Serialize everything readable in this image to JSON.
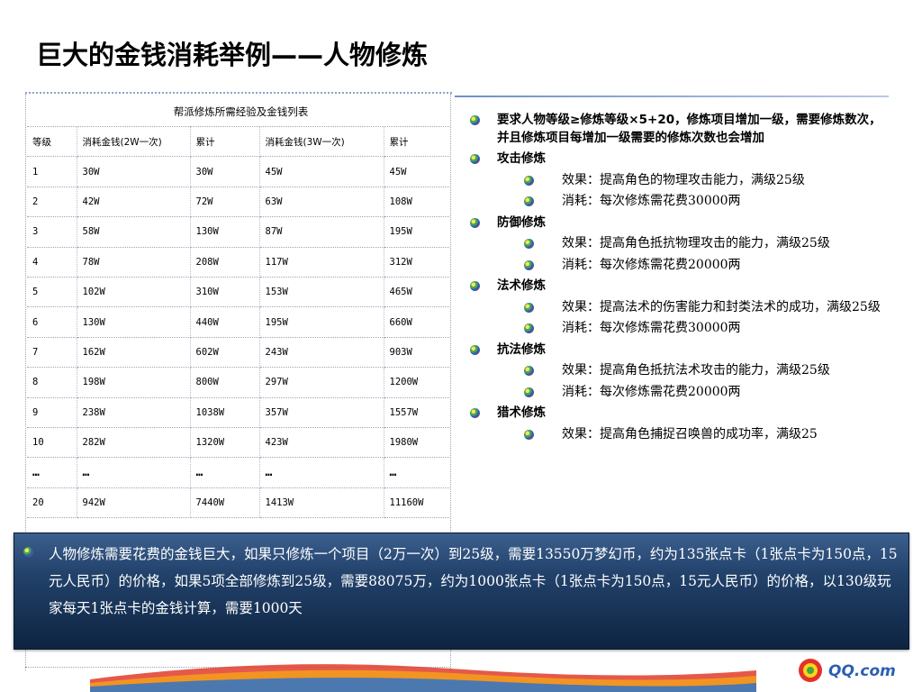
{
  "title": "巨大的金钱消耗举例——人物修炼",
  "table": {
    "caption": "帮派修炼所需经验及金钱列表",
    "headers": [
      "等级",
      "消耗金钱(2W一次)",
      "累计",
      "消耗金钱(3W一次)",
      "累计"
    ],
    "rows": [
      [
        "1",
        "30W",
        "30W",
        "45W",
        "45W"
      ],
      [
        "2",
        "42W",
        "72W",
        "63W",
        "108W"
      ],
      [
        "3",
        "58W",
        "130W",
        "87W",
        "195W"
      ],
      [
        "4",
        "78W",
        "208W",
        "117W",
        "312W"
      ],
      [
        "5",
        "102W",
        "310W",
        "153W",
        "465W"
      ],
      [
        "6",
        "130W",
        "440W",
        "195W",
        "660W"
      ],
      [
        "7",
        "162W",
        "602W",
        "243W",
        "903W"
      ],
      [
        "8",
        "198W",
        "800W",
        "297W",
        "1200W"
      ],
      [
        "9",
        "238W",
        "1038W",
        "357W",
        "1557W"
      ],
      [
        "10",
        "282W",
        "1320W",
        "423W",
        "1980W"
      ],
      [
        "…",
        "…",
        "…",
        "…",
        "…"
      ],
      [
        "20",
        "942W",
        "7440W",
        "1413W",
        "11160W"
      ]
    ]
  },
  "bullets": [
    {
      "level": 1,
      "text": "要求人物等级≥修炼等级×5+20，修炼项目增加一级，需要修炼数次，并且修炼项目每增加一级需要的修炼次数也会增加"
    },
    {
      "level": 1,
      "text": "攻击修炼"
    },
    {
      "level": 2,
      "text": "效果：提高角色的物理攻击能力，满级25级"
    },
    {
      "level": 2,
      "text": "消耗：每次修炼需花费30000两"
    },
    {
      "level": 1,
      "text": "防御修炼"
    },
    {
      "level": 2,
      "text": "效果：提高角色抵抗物理攻击的能力，满级25级"
    },
    {
      "level": 2,
      "text": "消耗：每次修炼需花费20000两"
    },
    {
      "level": 1,
      "text": "法术修炼"
    },
    {
      "level": 2,
      "text": "效果：提高法术的伤害能力和封类法术的成功，满级25级"
    },
    {
      "level": 2,
      "text": "消耗：每次修炼需花费30000两"
    },
    {
      "level": 1,
      "text": "抗法修炼"
    },
    {
      "level": 2,
      "text": "效果：提高角色抵抗法术攻击的能力，满级25级"
    },
    {
      "level": 2,
      "text": "消耗：每次修炼需花费20000两"
    },
    {
      "level": 1,
      "text": "猎术修炼"
    },
    {
      "level": 2,
      "text": "效果：提高角色捕捉召唤兽的成功率，满级25"
    }
  ],
  "banner": "人物修炼需要花费的金钱巨大，如果只修炼一个项目（2万一次）到25级，需要13550万梦幻币，约为135张点卡（1张点卡为150点，15元人民币）的价格，如果5项全部修炼到25级，需要88075万，约为1000张点卡（1张点卡为150点，15元人民币）的价格，以130级玩家每天1张点卡的金钱计算，需要1000天",
  "logo": {
    "text": "QQ.com",
    "name": "qq-logo"
  },
  "colors": {
    "banner_top": "#3c5f8e",
    "banner_bottom": "#0e2440",
    "accent": "#2b5fb2"
  }
}
